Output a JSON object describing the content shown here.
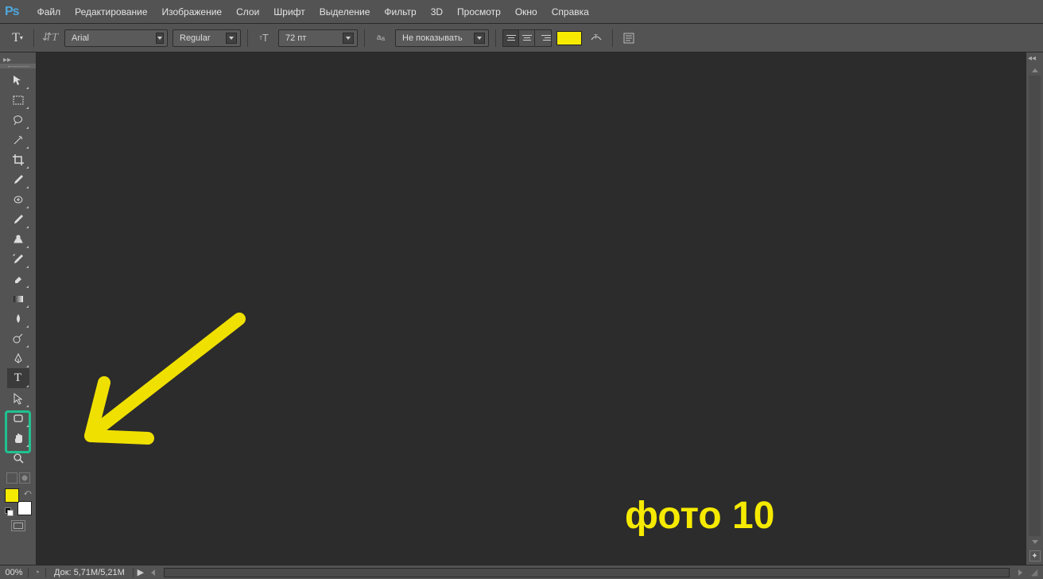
{
  "menus": [
    "Файл",
    "Редактирование",
    "Изображение",
    "Слои",
    "Шрифт",
    "Выделение",
    "Фильтр",
    "3D",
    "Просмотр",
    "Окно",
    "Справка"
  ],
  "options": {
    "font_family": "Arial",
    "font_weight": "Regular",
    "font_size": "72 пт",
    "antialias": "Не показывать",
    "text_color": "#f5ea00",
    "align_active": "left"
  },
  "tools": [
    {
      "name": "move-tool",
      "svg": "move"
    },
    {
      "name": "marquee-tool",
      "svg": "marquee"
    },
    {
      "name": "lasso-tool",
      "svg": "lasso"
    },
    {
      "name": "magic-wand-tool",
      "svg": "wand"
    },
    {
      "name": "crop-tool",
      "svg": "crop"
    },
    {
      "name": "eyedropper-tool",
      "svg": "eyedropper"
    },
    {
      "name": "healing-brush-tool",
      "svg": "patch"
    },
    {
      "name": "brush-tool",
      "svg": "brush"
    },
    {
      "name": "clone-stamp-tool",
      "svg": "stamp"
    },
    {
      "name": "history-brush-tool",
      "svg": "history"
    },
    {
      "name": "eraser-tool",
      "svg": "eraser"
    },
    {
      "name": "gradient-tool",
      "svg": "gradient"
    },
    {
      "name": "blur-tool",
      "svg": "blur"
    },
    {
      "name": "dodge-tool",
      "svg": "dodge"
    },
    {
      "name": "pen-tool",
      "svg": "pen"
    },
    {
      "name": "type-tool",
      "svg": "type",
      "active": true
    },
    {
      "name": "path-selection-tool",
      "svg": "path"
    },
    {
      "name": "shape-tool",
      "svg": "shape"
    },
    {
      "name": "hand-tool",
      "svg": "hand"
    },
    {
      "name": "zoom-tool",
      "svg": "zoom"
    }
  ],
  "swatch_fg": "#f5ea00",
  "status": {
    "zoom": "00%",
    "doc": "Док: 5,71M/5,21M"
  },
  "annotation": {
    "text": "фото 10",
    "arrow_color": "#f0e000"
  }
}
